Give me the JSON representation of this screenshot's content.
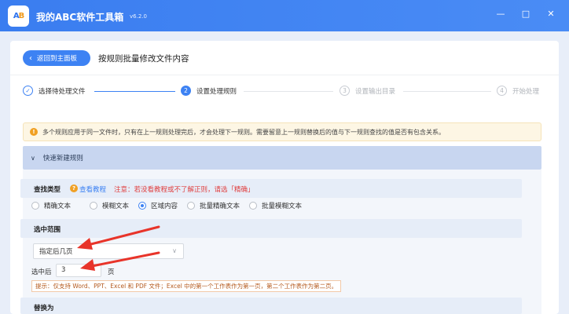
{
  "app": {
    "logo_a": "A",
    "logo_b": "B",
    "title": "我的ABC软件工具箱",
    "version": "v6.2.0"
  },
  "window_controls": {
    "minimize": "—",
    "maximize": "□",
    "close": "✕"
  },
  "header": {
    "back_label": "返回到主面板",
    "page_title": "按规则批量修改文件内容"
  },
  "steps": [
    {
      "num": "✓",
      "label": "选择待处理文件",
      "state": "done"
    },
    {
      "num": "2",
      "label": "设置处理规则",
      "state": "active"
    },
    {
      "num": "3",
      "label": "设置输出目录",
      "state": "todo"
    },
    {
      "num": "4",
      "label": "开始处理",
      "state": "todo"
    }
  ],
  "notice": {
    "icon": "!",
    "text": "多个规则应用于同一文件时，只有在上一规则处理完后，才会处理下一规则。需要留意上一规则替换后的值与下一规则查找的值是否有包含关系。"
  },
  "quick_rule": {
    "header": "快速新建规则",
    "find_type": {
      "label": "查找类型",
      "help_icon": "?",
      "tutorial_link": "查看教程",
      "warning": "注意：若没看教程或不了解正则，请选「精确」",
      "options": [
        "精确文本",
        "模糊文本",
        "区域内容",
        "批量精确文本",
        "批量模糊文本"
      ],
      "selected_index": 2
    },
    "range": {
      "label": "选中范围",
      "select_value": "指定后几页",
      "after_label": "选中后",
      "after_value": "3",
      "after_unit": "页",
      "tip": "提示：仅支持 Word、PPT、Excel 和 PDF 文件；Excel 中的第一个工作表作为第一页，第二个工作表作为第二页。"
    },
    "replace_label": "替换为"
  },
  "colors": {
    "accent": "#3d82f3",
    "warning": "#e04040",
    "annotation_arrow": "#e8342a"
  }
}
